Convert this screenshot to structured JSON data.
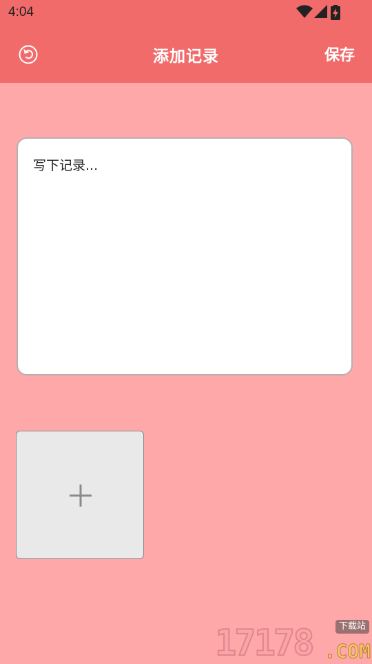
{
  "status_bar": {
    "time": "4:04",
    "icons": [
      "wifi-icon",
      "cellular-signal-icon",
      "battery-charging-icon"
    ]
  },
  "app_bar": {
    "title": "添加记录",
    "save_label": "保存",
    "back_icon": "back-circle-icon"
  },
  "note": {
    "placeholder": "写下记录...",
    "value": ""
  },
  "add_image": {
    "icon": "plus-icon"
  },
  "watermark": {
    "digits": "17178",
    "domain": ".COM",
    "tag": "下载站"
  },
  "colors": {
    "app_bar": "#F26B6B",
    "background": "#FFA8AA",
    "note_bg": "#FFFFFF",
    "add_tile": "#E9E9E9"
  }
}
